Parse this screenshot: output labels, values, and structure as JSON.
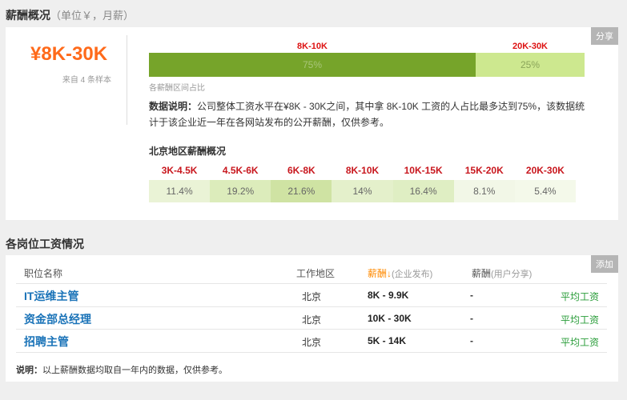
{
  "overview": {
    "title": "薪酬概况",
    "title_sub": "（单位￥，月薪）",
    "share_label": "分享",
    "salary_range": "¥8K-30K",
    "sample_note": "来自 4 条样本",
    "ranges": [
      {
        "label": "8K-10K",
        "percent_text": "75%",
        "fraction": 0.75,
        "color": "#76a42a",
        "text_color": "#a9c67a"
      },
      {
        "label": "20K-30K",
        "percent_text": "25%",
        "fraction": 0.25,
        "color": "#cde88f",
        "text_color": "#8aa45a"
      }
    ],
    "bar_caption": "各薪酬区间占比",
    "desc_label": "数据说明：",
    "desc_text": "公司整体工资水平在¥8K - 30K之间，其中拿 8K-10K 工资的人占比最多达到75%，该数据统计于该企业近一年在各网站发布的公开薪酬，仅供参考。"
  },
  "region": {
    "title": "北京地区薪酬概况",
    "columns": [
      {
        "label": "3K-4.5K",
        "value": "11.4%",
        "bg": "#eaf3d6"
      },
      {
        "label": "4.5K-6K",
        "value": "19.2%",
        "bg": "#dcecbb"
      },
      {
        "label": "6K-8K",
        "value": "21.6%",
        "bg": "#cfe3a3"
      },
      {
        "label": "8K-10K",
        "value": "14%",
        "bg": "#e4f0cb"
      },
      {
        "label": "10K-15K",
        "value": "16.4%",
        "bg": "#dfeec3"
      },
      {
        "label": "15K-20K",
        "value": "8.1%",
        "bg": "#f2f7e7"
      },
      {
        "label": "20K-30K",
        "value": "5.4%",
        "bg": "#f4f9ea"
      }
    ]
  },
  "jobs": {
    "title": "各岗位工资情况",
    "add_label": "添加",
    "headers": {
      "position": "职位名称",
      "location": "工作地区",
      "salary": "薪酬↓",
      "salary_note": "(企业发布)",
      "user_salary": "薪酬",
      "user_note": "(用户分享)"
    },
    "rows": [
      {
        "title": "IT运维主管",
        "city": "北京",
        "salary": "8K - 9.9K",
        "user": "-",
        "avg": "平均工资"
      },
      {
        "title": "资金部总经理",
        "city": "北京",
        "salary": "10K - 30K",
        "user": "-",
        "avg": "平均工资"
      },
      {
        "title": "招聘主管",
        "city": "北京",
        "salary": "5K - 14K",
        "user": "-",
        "avg": "平均工资"
      }
    ],
    "note_label": "说明：",
    "note_text": "以上薪酬数据均取自一年内的数据，仅供参考。"
  }
}
